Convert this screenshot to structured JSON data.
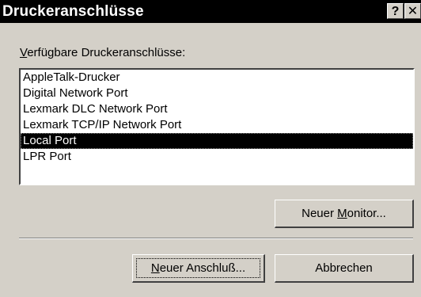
{
  "dialog": {
    "title": "Druckeranschlüsse",
    "help_button": "?",
    "close_button": "✕"
  },
  "ports": {
    "label_mnemonic": "V",
    "label_rest": "erfügbare Druckeranschlüsse:",
    "items": [
      {
        "label": "AppleTalk-Drucker",
        "selected": false
      },
      {
        "label": "Digital Network Port",
        "selected": false
      },
      {
        "label": "Lexmark DLC Network Port",
        "selected": false
      },
      {
        "label": "Lexmark TCP/IP Network Port",
        "selected": false
      },
      {
        "label": "Local Port",
        "selected": true
      },
      {
        "label": "LPR Port",
        "selected": false
      }
    ]
  },
  "buttons": {
    "new_monitor_pre": "Neuer ",
    "new_monitor_mnemonic": "M",
    "new_monitor_post": "onitor...",
    "new_port_mnemonic": "N",
    "new_port_post": "euer Anschluß...",
    "cancel": "Abbrechen"
  },
  "colors": {
    "face": "#d4d0c8",
    "titlebar": "#000000",
    "selection": "#000000"
  }
}
